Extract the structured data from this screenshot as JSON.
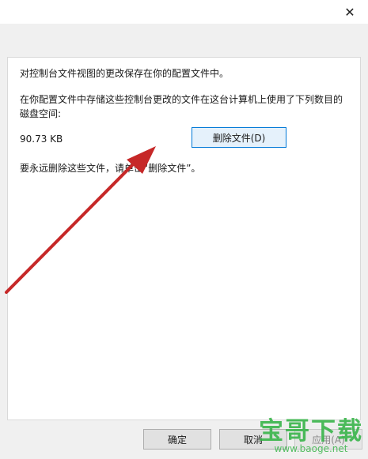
{
  "window": {
    "close_glyph": "✕"
  },
  "panel": {
    "line1": "对控制台文件视图的更改保存在你的配置文件中。",
    "line2a": "在你配置文件中存储这些控制台更改的文件在这台计算机上使用了下列数目的",
    "line2b": "磁盘空间:",
    "size": "90.73 KB",
    "delete_button": "删除文件(D)",
    "line3": "要永远删除这些文件，请单击“删除文件”。"
  },
  "footer": {
    "ok_label": "确定",
    "cancel_label": "取消",
    "apply_label": "应用(A)"
  },
  "watermark": {
    "main": "宝哥下载",
    "url": "www.baoge.net"
  },
  "annotation": {
    "arrow_color": "#c62828"
  }
}
